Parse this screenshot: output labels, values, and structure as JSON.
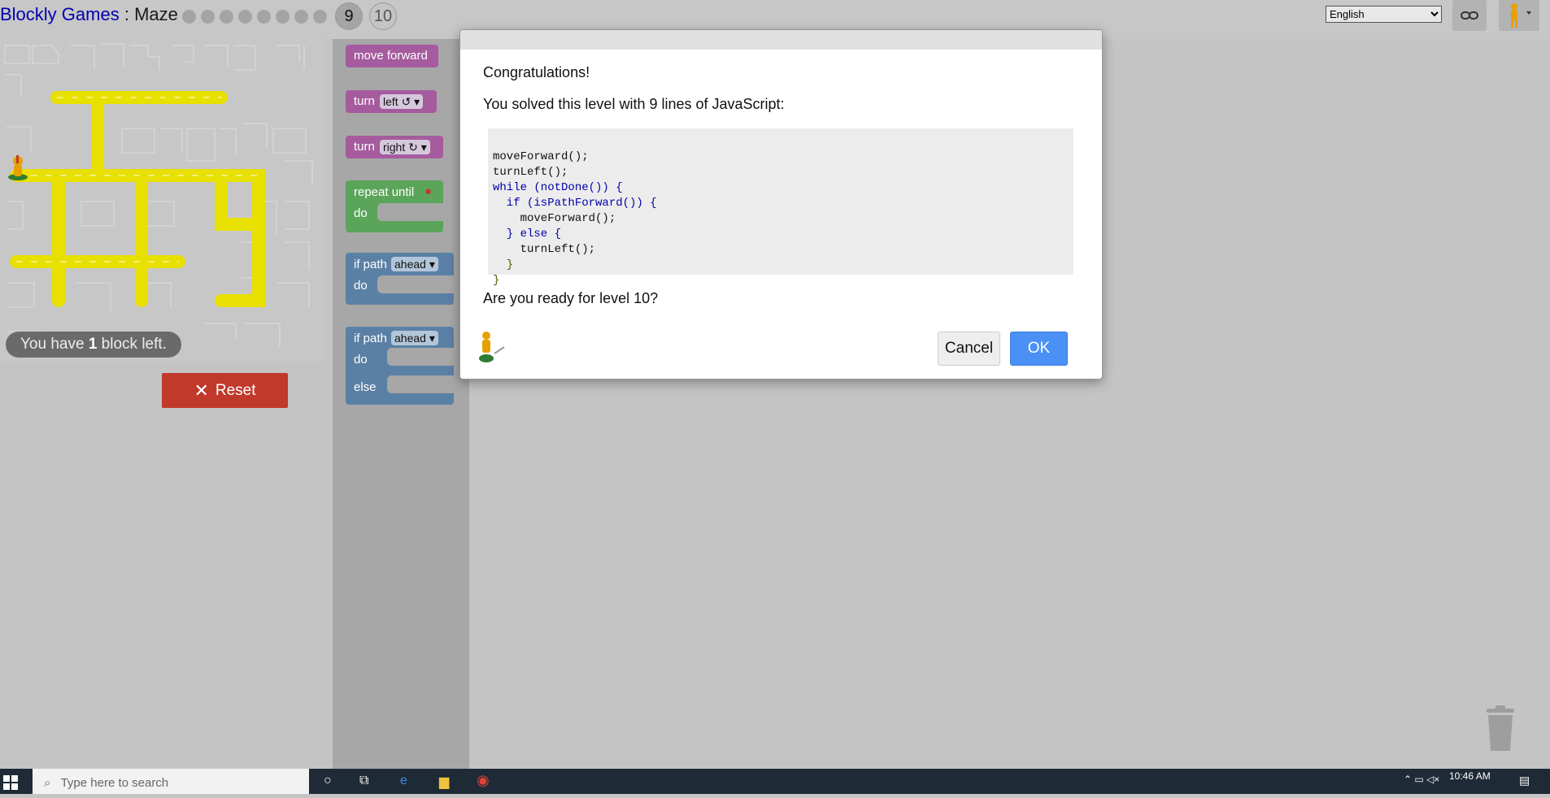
{
  "header": {
    "app_title": "Blockly Games",
    "separator": " : ",
    "game_title": "Maze",
    "levels_done": 8,
    "current_level": "9",
    "next_level": "10",
    "language": "English",
    "language_options": [
      "English"
    ]
  },
  "maze": {
    "status_prefix": "You have ",
    "status_count": "1",
    "status_suffix": " block left.",
    "reset_label": "Reset",
    "reset_icon": "x-icon"
  },
  "toolbox": {
    "move_forward": "move forward",
    "turn_label": "turn",
    "turn_left_value": "left ↺",
    "turn_right_value": "right ↻",
    "repeat_until": "repeat until",
    "do_label": "do",
    "if_path_label": "if path",
    "ahead_value": "ahead",
    "else_label": "else"
  },
  "dialog": {
    "heading": "Congratulations!",
    "message": "You solved this level with 9 lines of JavaScript:",
    "code_lines": [
      "moveForward();",
      "turnLeft();",
      "while (notDone()) {",
      "  if (isPathForward()) {",
      "    moveForward();",
      "  } else {",
      "    turnLeft();",
      "  }",
      "}"
    ],
    "question": "Are you ready for level 10?",
    "cancel_label": "Cancel",
    "ok_label": "OK"
  },
  "taskbar": {
    "search_placeholder": "Type here to search",
    "time": "10:46 AM"
  },
  "colors": {
    "path": "#e8e000",
    "motion_block": "#a55b9e",
    "loop_block": "#5ba55b",
    "logic_block": "#5b80a5",
    "reset": "#c0392b",
    "ok_button": "#4a90f5",
    "link": "#0000b3"
  }
}
